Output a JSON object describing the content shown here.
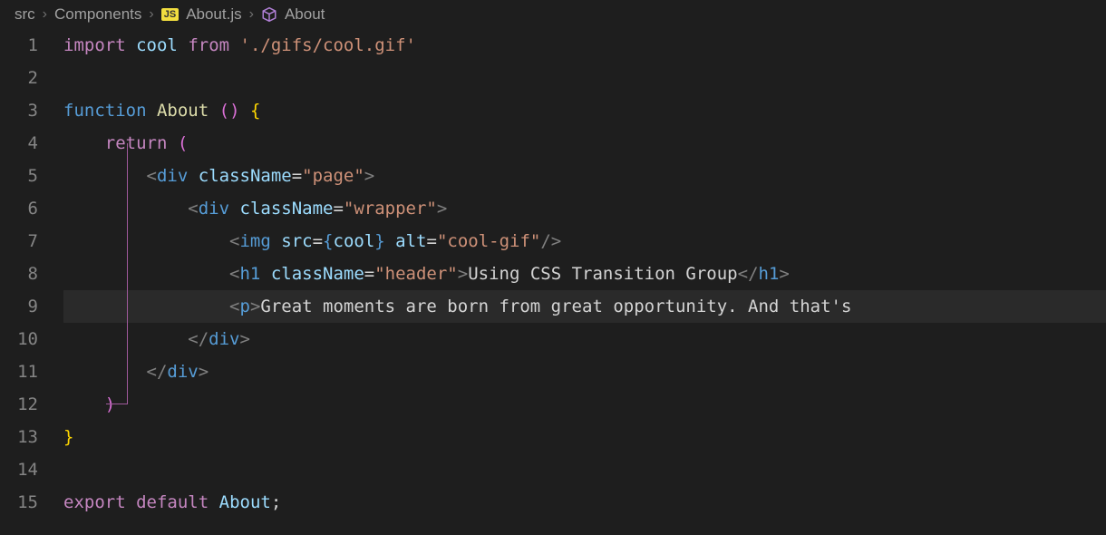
{
  "breadcrumb": {
    "seg1": "src",
    "seg2": "Components",
    "badge": "JS",
    "seg3": "About.js",
    "seg4": "About"
  },
  "gutter": {
    "l1": "1",
    "l2": "2",
    "l3": "3",
    "l4": "4",
    "l5": "5",
    "l6": "6",
    "l7": "7",
    "l8": "8",
    "l9": "9",
    "l10": "10",
    "l11": "11",
    "l12": "12",
    "l13": "13",
    "l14": "14",
    "l15": "15"
  },
  "code": {
    "l1": {
      "kw_import": "import",
      "var_cool": "cool",
      "kw_from": "from",
      "str_path": "'./gifs/cool.gif'"
    },
    "l3": {
      "kw_function": "function",
      "fn_about": "About",
      "paren_open": "(",
      "paren_close": ")",
      "brace_open": "{"
    },
    "l4": {
      "kw_return": "return",
      "paren_open": "("
    },
    "l5": {
      "tag_open": "<",
      "tag_div": "div",
      "attr_cn": "className",
      "eq": "=",
      "str_page": "\"page\"",
      "tag_close": ">"
    },
    "l6": {
      "tag_open": "<",
      "tag_div": "div",
      "attr_cn": "className",
      "eq": "=",
      "str_wrapper": "\"wrapper\"",
      "tag_close": ">"
    },
    "l7": {
      "tag_open": "<",
      "tag_img": "img",
      "attr_src": "src",
      "eq1": "=",
      "curly_open": "{",
      "var_cool": "cool",
      "curly_close": "}",
      "attr_alt": "alt",
      "eq2": "=",
      "str_alt": "\"cool-gif\"",
      "tag_selfclose": "/>"
    },
    "l8": {
      "tag_open": "<",
      "tag_h1": "h1",
      "attr_cn": "className",
      "eq": "=",
      "str_header": "\"header\"",
      "tag_close": ">",
      "text": "Using CSS Transition Group",
      "tag_end_open": "</",
      "tag_h1_end": "h1",
      "tag_end_close": ">"
    },
    "l9": {
      "tag_open": "<",
      "tag_p": "p",
      "tag_close": ">",
      "text": "Great moments are born from great opportunity. And that's"
    },
    "l10": {
      "tag_end_open": "</",
      "tag_div": "div",
      "tag_end_close": ">"
    },
    "l11": {
      "tag_end_open": "</",
      "tag_div": "div",
      "tag_end_close": ">"
    },
    "l12": {
      "paren_close": ")"
    },
    "l13": {
      "brace_close": "}"
    },
    "l15": {
      "kw_export": "export",
      "kw_default": "default",
      "var_about": "About",
      "semi": ";"
    }
  }
}
